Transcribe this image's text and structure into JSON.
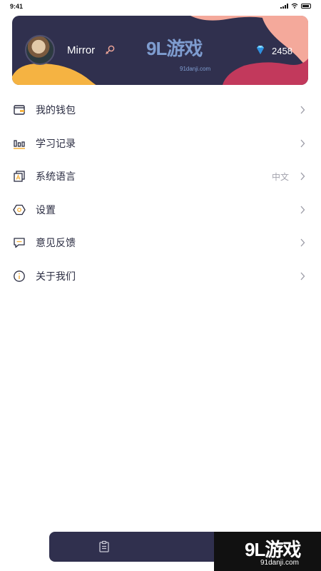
{
  "status_bar": {
    "time": "9:41"
  },
  "profile": {
    "username": "Mirror",
    "diamond_count": "2458",
    "gender_icon": "female-icon",
    "diamond_icon": "diamond-icon"
  },
  "watermark": {
    "logo": "9L游戏",
    "sub": "91danji.com"
  },
  "menu": {
    "items": [
      {
        "label": "我的钱包",
        "icon": "wallet-icon"
      },
      {
        "label": "学习记录",
        "icon": "bar-chart-icon"
      },
      {
        "label": "系统语言",
        "icon": "language-icon",
        "value": "中文"
      },
      {
        "label": "设置",
        "icon": "settings-icon"
      },
      {
        "label": "意见反馈",
        "icon": "feedback-icon"
      },
      {
        "label": "关于我们",
        "icon": "info-icon"
      }
    ]
  },
  "bottom_bar": {
    "tab_icon": "clipboard-icon"
  },
  "colors": {
    "card_bg": "#30304e",
    "accent_yellow": "#f5b342",
    "accent_pink": "#f4a99b",
    "accent_red": "#c2395c"
  }
}
